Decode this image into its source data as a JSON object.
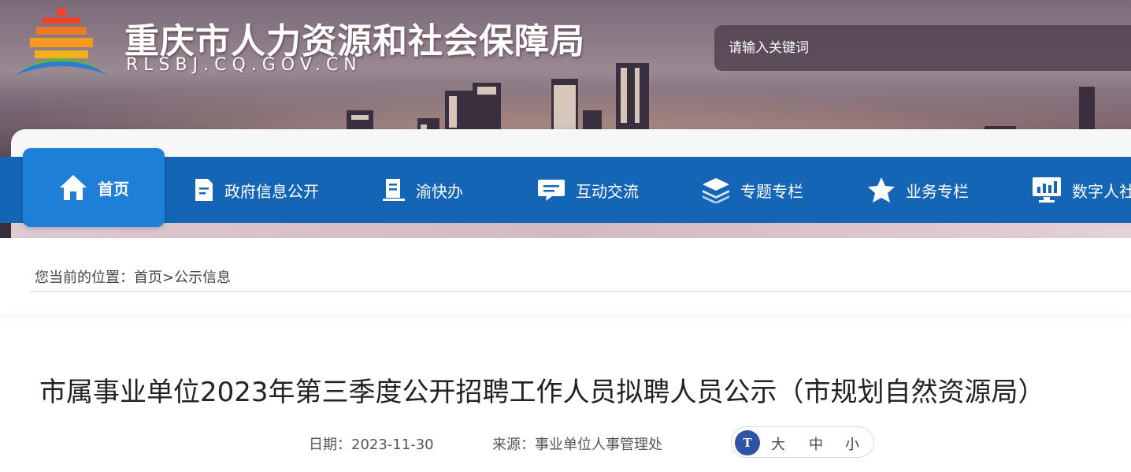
{
  "site": {
    "title": "重庆市人力资源和社会保障局",
    "domain": "RLSBJ.CQ.GOV.CN"
  },
  "search": {
    "placeholder": "请输入关键词"
  },
  "nav": {
    "items": [
      {
        "label": "首页",
        "icon": "home-icon",
        "active": true
      },
      {
        "label": "政府信息公开",
        "icon": "document-icon"
      },
      {
        "label": "渝快办",
        "icon": "book-icon"
      },
      {
        "label": "互动交流",
        "icon": "chat-icon"
      },
      {
        "label": "专题专栏",
        "icon": "layers-icon"
      },
      {
        "label": "业务专栏",
        "icon": "star-icon"
      },
      {
        "label": "数字人社",
        "icon": "monitor-chart-icon"
      }
    ]
  },
  "breadcrumb": {
    "prefix": "您当前的位置：",
    "home": "首页",
    "separator": ">",
    "current": "公示信息"
  },
  "article": {
    "title": "市属事业单位2023年第三季度公开招聘工作人员拟聘人员公示（市规划自然资源局）",
    "date_label": "日期：",
    "date": "2023-11-30",
    "source_label": "来源：",
    "source": "事业单位人事管理处",
    "font_size": {
      "icon_text": "T",
      "large": "大",
      "medium": "中",
      "small": "小"
    }
  },
  "colors": {
    "nav_bg": "#1565b7",
    "nav_active": "#1d7fd8",
    "font_icon": "#2f54a5"
  }
}
